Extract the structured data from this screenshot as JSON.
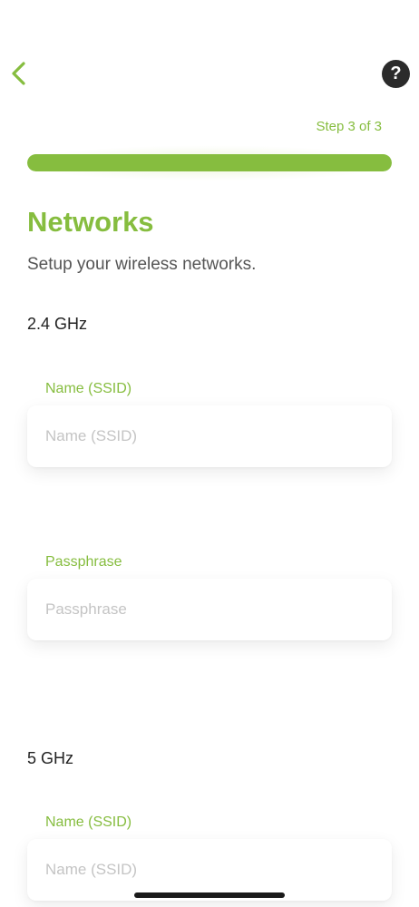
{
  "header": {
    "back_icon": "chevron-left-icon",
    "help_icon": "question-mark-icon",
    "help_glyph": "?"
  },
  "progress": {
    "step_text": "Step 3 of 3",
    "fraction": 1.0
  },
  "page": {
    "title": "Networks",
    "subtitle": "Setup your wireless networks."
  },
  "band_24": {
    "heading": "2.4 GHz",
    "ssid": {
      "label": "Name (SSID)",
      "placeholder": "Name (SSID)",
      "value": ""
    },
    "passphrase": {
      "label": "Passphrase",
      "placeholder": "Passphrase",
      "value": ""
    }
  },
  "band_5": {
    "heading": "5 GHz",
    "ssid": {
      "label": "Name (SSID)",
      "placeholder": "Name (SSID)",
      "value": ""
    }
  },
  "colors": {
    "accent": "#86bd3f",
    "help_button": "#2b2b2b",
    "placeholder": "#c4c4c4"
  }
}
